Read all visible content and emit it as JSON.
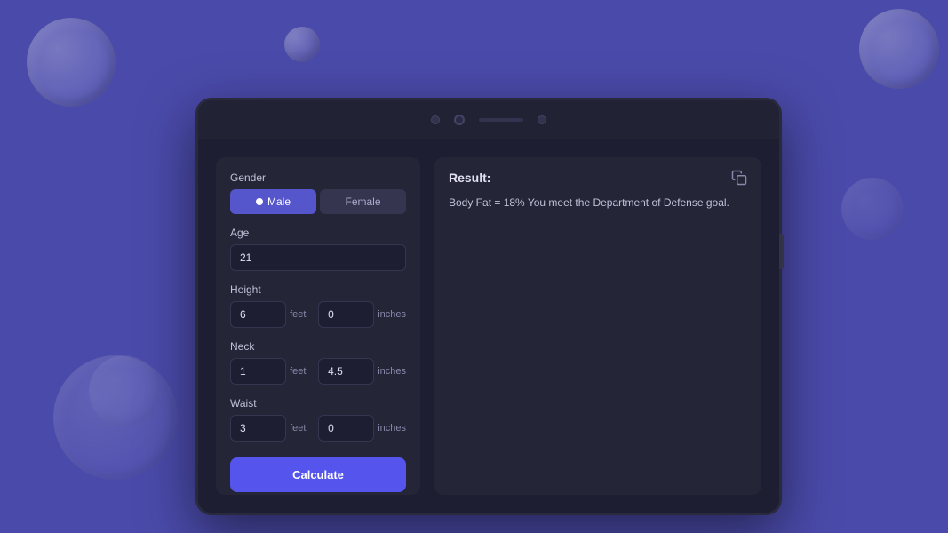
{
  "background": {
    "color": "#4a4aaa"
  },
  "tablet": {
    "topbar": {
      "camera_label": "camera",
      "speaker_label": "speaker"
    },
    "form": {
      "gender_label": "Gender",
      "gender_options": [
        {
          "id": "male",
          "label": "Male",
          "active": true
        },
        {
          "id": "female",
          "label": "Female",
          "active": false
        }
      ],
      "age_label": "Age",
      "age_value": "21",
      "age_placeholder": "21",
      "height_label": "Height",
      "height_feet_value": "6",
      "height_feet_placeholder": "6",
      "height_inches_value": "0",
      "height_inches_placeholder": "0",
      "neck_label": "Neck",
      "neck_feet_value": "1",
      "neck_feet_placeholder": "1",
      "neck_inches_value": "4.5",
      "neck_inches_placeholder": "4.5",
      "waist_label": "Waist",
      "waist_feet_value": "3",
      "waist_feet_placeholder": "3",
      "waist_inches_value": "0",
      "waist_inches_placeholder": "0",
      "feet_unit": "feet",
      "inches_unit": "inches",
      "calculate_btn": "Calculate"
    },
    "result": {
      "title": "Result:",
      "text": "Body Fat = 18% You meet the Department of Defense goal.",
      "copy_icon_label": "copy"
    }
  }
}
